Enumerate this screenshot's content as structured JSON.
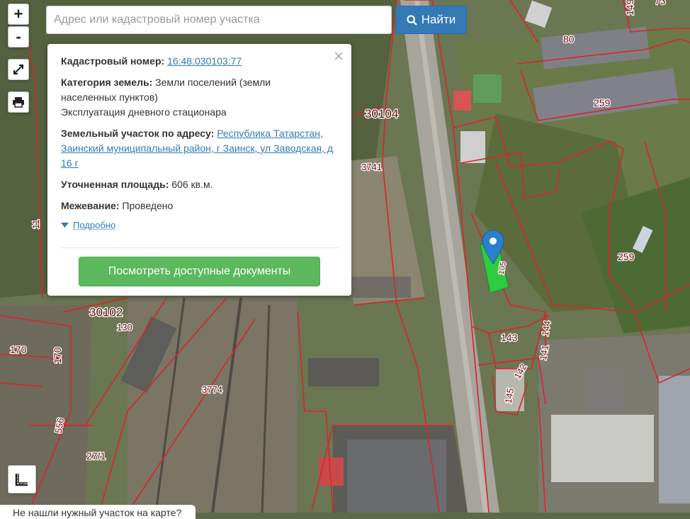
{
  "search": {
    "placeholder": "Адрес или кадастровый номер участка",
    "button_label": "Найти"
  },
  "controls": {
    "zoom_in": "+",
    "zoom_out": "-"
  },
  "popup": {
    "cadastral_label": "Кадастровый номер:",
    "cadastral_value": "16:48:030103:77",
    "category_label": "Категория земель:",
    "category_value": "Земли поселений (земли населенных пунктов)",
    "category_use": "Эксплуатация дневного стационара",
    "address_label": "Земельный участок по адресу:",
    "address_value": "Республика Татарстан, Заинский муниципальный район, г Заинск, ул Заводская, д 16 г",
    "area_label": "Уточненная площадь:",
    "area_value": "606 кв.м.",
    "survey_label": "Межевание:",
    "survey_value": "Проведено",
    "details_link": "Подробно",
    "docs_button": "Посмотреть доступные документы"
  },
  "map": {
    "labels": [
      "149",
      "73",
      "80",
      "259",
      "30104",
      "3741",
      "130",
      "30102",
      "170",
      "170",
      "11",
      "556",
      "27/1",
      "3774",
      "259",
      "143",
      "144",
      "141",
      "142",
      "145",
      "105"
    ]
  },
  "bottom_bar": {
    "text": "Не нашли нужный участок на карте?"
  },
  "colors": {
    "search_button": "#337ab7",
    "docs_button": "#5cb85c",
    "parcel_border": "#d9252a",
    "selected_parcel": "#2ecc40",
    "marker": "#2a81cb"
  }
}
